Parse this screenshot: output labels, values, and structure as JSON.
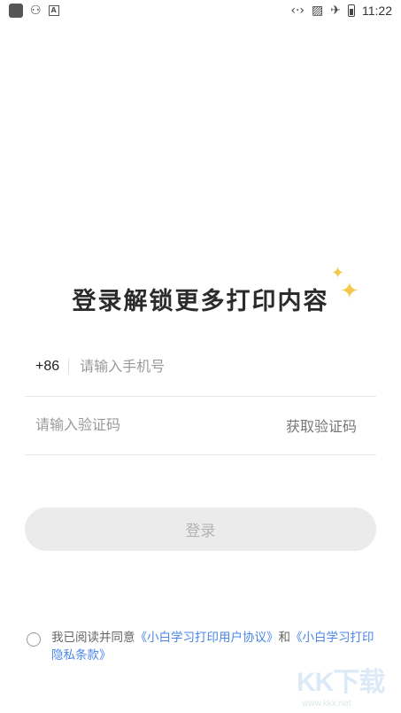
{
  "status_bar": {
    "time": "11:22",
    "left_icons": [
      "app-square-icon",
      "notification-glyph-icon",
      "a-icon"
    ],
    "right_icons": [
      "link-icon",
      "no-sim-icon",
      "airplane-icon",
      "battery-icon"
    ]
  },
  "login": {
    "title": "登录解锁更多打印内容",
    "country_code": "+86",
    "phone_placeholder": "请输入手机号",
    "code_placeholder": "请输入验证码",
    "get_code_label": "获取验证码",
    "login_label": "登录",
    "disabled_color": "#ebebeb"
  },
  "agreement": {
    "prefix": "我已阅读并同意",
    "user_agreement": "《小白学习打印用户协议》",
    "and": "和",
    "privacy_policy": "《小白学习打印隐私条款》",
    "link_color": "#4a86e8"
  },
  "watermark": {
    "logo": "KK下载",
    "url": "www.kkx.net"
  }
}
